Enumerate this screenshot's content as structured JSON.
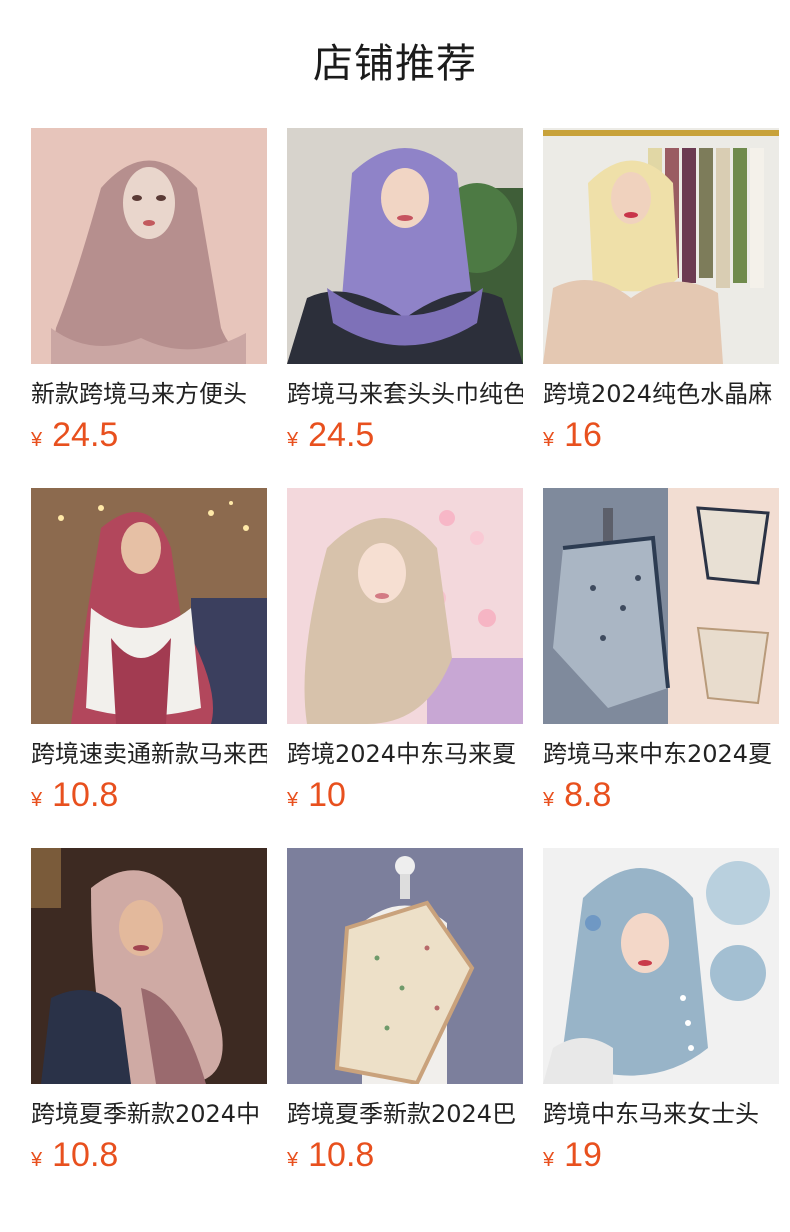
{
  "page": {
    "title": "店铺推荐"
  },
  "theme": {
    "price_color": "#e8501e",
    "text_color": "#222222"
  },
  "products": [
    {
      "name": "新款跨境马来方便头",
      "currency": "¥",
      "price": "24.5",
      "image": "dusty-pink-hijab-on-mannequin"
    },
    {
      "name": "跨境马来套头头巾纯色",
      "currency": "¥",
      "price": "24.5",
      "image": "lavender-pleated-hijab-model"
    },
    {
      "name": "跨境2024纯色水晶麻",
      "currency": "¥",
      "price": "16",
      "image": "cream-ruffle-hijab-with-rack"
    },
    {
      "name": "跨境速卖通新款马来西",
      "currency": "¥",
      "price": "10.8",
      "image": "burgundy-print-scarf-model"
    },
    {
      "name": "跨境2024中东马来夏",
      "currency": "¥",
      "price": "10",
      "image": "beige-hijab-floral-background"
    },
    {
      "name": "跨境马来中东2024夏",
      "currency": "¥",
      "price": "8.8",
      "image": "grey-leopard-print-scarf-mannequin"
    },
    {
      "name": "跨境夏季新款2024中",
      "currency": "¥",
      "price": "10.8",
      "image": "pink-pattern-scarf-model"
    },
    {
      "name": "跨境夏季新款2024巴",
      "currency": "¥",
      "price": "10.8",
      "image": "floral-cream-scarf-mannequin"
    },
    {
      "name": "跨境中东马来女士头",
      "currency": "¥",
      "price": "19",
      "image": "blue-pearl-hijab-model"
    }
  ]
}
